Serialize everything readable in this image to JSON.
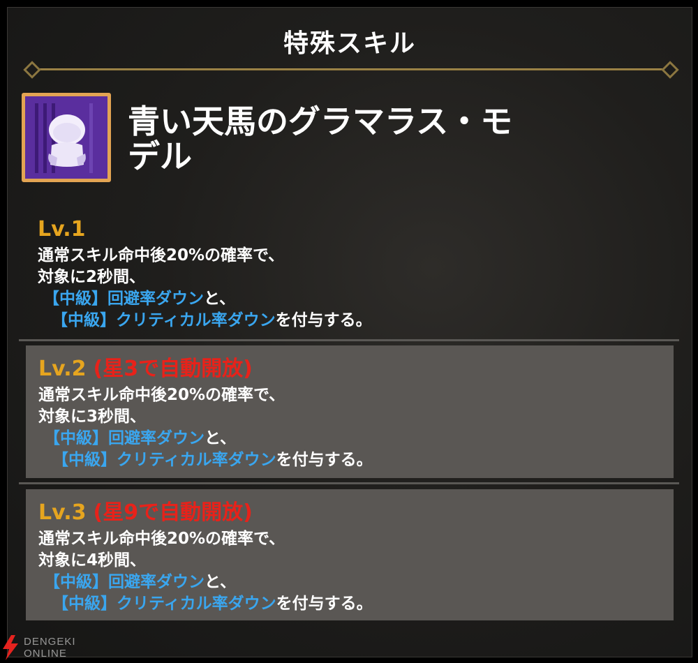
{
  "header": {
    "title": "特殊スキル"
  },
  "skill": {
    "name_line1": "青い天馬のグラマラス・モ",
    "name_line2": "デル",
    "icon": "purple-avatar-icon"
  },
  "levels": [
    {
      "label": "Lv.1",
      "unlock": "",
      "line1": "通常スキル命中後20%の確率で、",
      "line2": "対象に2秒間、",
      "tag1": "【中級】回避率ダウン",
      "tail1": "と、",
      "tag2": "【中級】クリティカル率ダウン",
      "tail2": "を付与する。"
    },
    {
      "label": "Lv.2",
      "unlock": "(星3で自動開放)",
      "line1": "通常スキル命中後20%の確率で、",
      "line2": "対象に3秒間、",
      "tag1": "【中級】回避率ダウン",
      "tail1": "と、",
      "tag2": "【中級】クリティカル率ダウン",
      "tail2": "を付与する。"
    },
    {
      "label": "Lv.3",
      "unlock": "(星9で自動開放)",
      "line1": "通常スキル命中後20%の確率で、",
      "line2": "対象に4秒間、",
      "tag1": "【中級】回避率ダウン",
      "tail1": "と、",
      "tag2": "【中級】クリティカル率ダウン",
      "tail2": "を付与する。"
    }
  ],
  "watermark": {
    "line1": "DENGEKI",
    "line2": "ONLINE",
    "icon": "lightning-bolt-icon"
  },
  "colors": {
    "accent_gold": "#e6a51f",
    "unlock_red": "#e8221a",
    "highlight_blue": "#3aa6ef",
    "locked_panel": "#5a5754"
  }
}
